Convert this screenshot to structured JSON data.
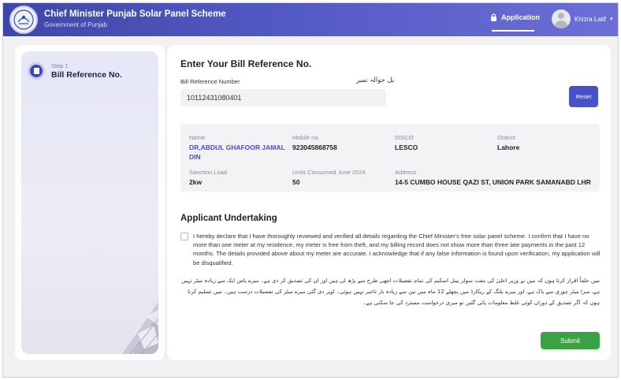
{
  "header": {
    "title": "Chief Minister Punjab Solar Panel Scheme",
    "subtitle": "Government of Punjab",
    "nav_application": "Application",
    "user_name": "Khizra Latif",
    "caret": "▾"
  },
  "stepper": {
    "step_number": "Step 1",
    "step_title": "Bill Reference No."
  },
  "form": {
    "heading": "Enter Your Bill Reference No.",
    "bill_label": "Bill Reference Number",
    "bill_label_urdu": "بل حوالہ نمبر",
    "bill_value": "10112431080401",
    "reset_label": "Reset"
  },
  "details": {
    "name_label": "Name",
    "name_value": "DR,ABDUL GHAFOOR JAMAL DIN",
    "mobile_label": "Mobile no.",
    "mobile_value": "923045868758",
    "disco_label": "DISCO",
    "disco_value": "LESCO",
    "district_label": "District",
    "district_value": "Lahore",
    "sanction_label": "Sanction Load",
    "sanction_value": "2kw",
    "units_label": "Units Consumed June 2024",
    "units_value": "50",
    "address_label": "Address",
    "address_value": "14-5 CUMBO HOUSE QAZI ST, UNION PARK SAMANABD LHR"
  },
  "undertaking": {
    "heading": "Applicant Undertaking",
    "text_en": "I hereby declare that I have thoroughly reviewed and verified all details regarding the Chief Minister's free solar panel scheme. I confirm that I have no more than one meter at my residence, my meter is free from theft, and my billing record does not show more than three late payments in the past 12 months. The details provided above about my meter are accurate. I acknowledge that if any false information is found upon verification, my application will be disqualified.",
    "text_ur": "میں حلفاً اقرار کرتا ہوں کہ میں نے وزیر اعلیٰ کی مفت سولر پینل اسکیم کی تمام تفصیلات اچھی طرح سے پڑھ لی ہیں اور ان کی تصدیق کر دی ہے۔ میرے پاس ایک سے زیادہ میٹر نہیں ہے، میرا میٹر چوری سے پاک ہے، اور میرے بلنگ کے ریکارڈ میں پچھلے 12 ماہ میں تین سے زیادہ بار تاخیر نہیں ہوئی۔ اوپر دی گئی میرے میٹر کی تفصیلات درست ہیں۔ میں تسلیم کرتا ہوں کہ اگر تصدیق کے دوران کوئی غلط معلومات پائی گئیں تو میری درخواست مسترد کی جا سکتی ہے۔",
    "submit_label": "Submit"
  },
  "colors": {
    "header_start": "#3e47a8",
    "header_end": "#6b6fd6",
    "accent": "#4951c9",
    "submit": "#3ba244"
  }
}
